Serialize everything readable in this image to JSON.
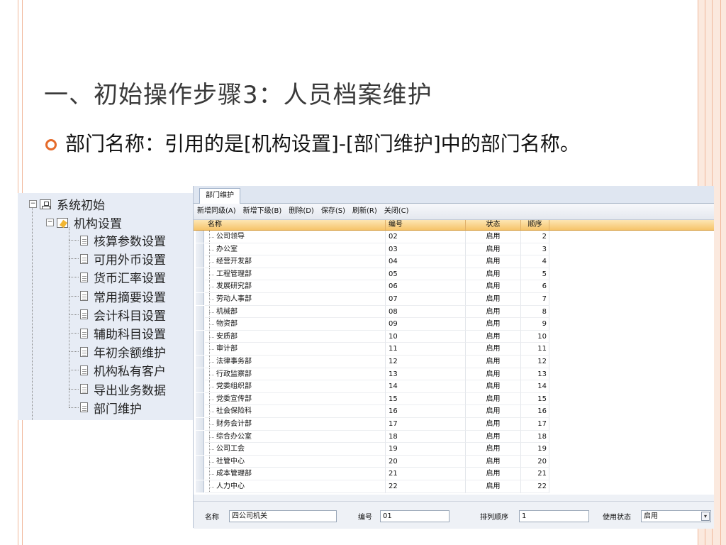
{
  "slide": {
    "title": "一、初始操作步骤3：人员档案维护",
    "bullet": "部门名称：引用的是[机构设置]-[部门维护]中的部门名称。"
  },
  "tree": {
    "root": "系统初始",
    "group": "机构设置",
    "items": [
      "核算参数设置",
      "可用外币设置",
      "货币汇率设置",
      "常用摘要设置",
      "会计科目设置",
      "辅助科目设置",
      "年初余额维护",
      "机构私有客户",
      "导出业务数据",
      "部门维护"
    ]
  },
  "app": {
    "tab": "部门维护",
    "toolbar": [
      "新增同级(A)",
      "新增下级(B)",
      "删除(D)",
      "保存(S)",
      "刷新(R)",
      "关闭(C)"
    ],
    "columns": [
      "名称",
      "编号",
      "状态",
      "顺序"
    ],
    "rows": [
      {
        "name": "公司领导",
        "code": "02",
        "status": "启用",
        "order": "2"
      },
      {
        "name": "办公室",
        "code": "03",
        "status": "启用",
        "order": "3"
      },
      {
        "name": "经营开发部",
        "code": "04",
        "status": "启用",
        "order": "4"
      },
      {
        "name": "工程管理部",
        "code": "05",
        "status": "启用",
        "order": "5"
      },
      {
        "name": "发展研究部",
        "code": "06",
        "status": "启用",
        "order": "6"
      },
      {
        "name": "劳动人事部",
        "code": "07",
        "status": "启用",
        "order": "7"
      },
      {
        "name": "机械部",
        "code": "08",
        "status": "启用",
        "order": "8"
      },
      {
        "name": "物资部",
        "code": "09",
        "status": "启用",
        "order": "9"
      },
      {
        "name": "安质部",
        "code": "10",
        "status": "启用",
        "order": "10"
      },
      {
        "name": "审计部",
        "code": "11",
        "status": "启用",
        "order": "11"
      },
      {
        "name": "法律事务部",
        "code": "12",
        "status": "启用",
        "order": "12"
      },
      {
        "name": "行政监察部",
        "code": "13",
        "status": "启用",
        "order": "13"
      },
      {
        "name": "党委组织部",
        "code": "14",
        "status": "启用",
        "order": "14"
      },
      {
        "name": "党委宣传部",
        "code": "15",
        "status": "启用",
        "order": "15"
      },
      {
        "name": "社会保险科",
        "code": "16",
        "status": "启用",
        "order": "16"
      },
      {
        "name": "财务会计部",
        "code": "17",
        "status": "启用",
        "order": "17"
      },
      {
        "name": "综合办公室",
        "code": "18",
        "status": "启用",
        "order": "18"
      },
      {
        "name": "公司工会",
        "code": "19",
        "status": "启用",
        "order": "19"
      },
      {
        "name": "社管中心",
        "code": "20",
        "status": "启用",
        "order": "20"
      },
      {
        "name": "成本管理部",
        "code": "21",
        "status": "启用",
        "order": "21"
      },
      {
        "name": "人力中心",
        "code": "22",
        "status": "启用",
        "order": "22"
      }
    ],
    "form": {
      "name_label": "名称",
      "name_value": "四公司机关",
      "code_label": "编号",
      "code_value": "01",
      "order_label": "排列顺序",
      "order_value": "1",
      "state_label": "使用状态",
      "state_value": "启用"
    }
  },
  "colors": {
    "accent": "#e56b2b",
    "header": "#f6c46a",
    "panel": "#e7ecf5"
  }
}
